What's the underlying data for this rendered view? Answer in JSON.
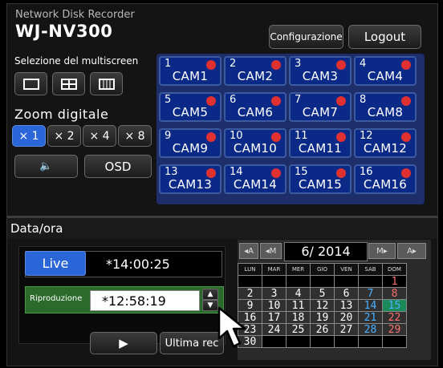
{
  "header": {
    "subtitle": "Network Disk Recorder",
    "model": "WJ-NV300",
    "config_label": "Configurazione",
    "logout_label": "Logout"
  },
  "multiscreen": {
    "title": "Selezione del multiscreen",
    "icons": [
      "single-screen-icon",
      "quad-screen-icon",
      "sixteen-screen-icon"
    ]
  },
  "zoom": {
    "title": "Zoom digitale",
    "options": [
      "× 1",
      "× 2",
      "× 4",
      "× 8"
    ],
    "active": "× 1"
  },
  "controls": {
    "audio_icon": "speaker-icon",
    "osd_label": "OSD"
  },
  "cameras": [
    {
      "num": "1",
      "name": "CAM1"
    },
    {
      "num": "2",
      "name": "CAM2"
    },
    {
      "num": "3",
      "name": "CAM3"
    },
    {
      "num": "4",
      "name": "CAM4"
    },
    {
      "num": "5",
      "name": "CAM5"
    },
    {
      "num": "6",
      "name": "CAM6"
    },
    {
      "num": "7",
      "name": "CAM7"
    },
    {
      "num": "8",
      "name": "CAM8"
    },
    {
      "num": "9",
      "name": "CAM9"
    },
    {
      "num": "10",
      "name": "CAM10"
    },
    {
      "num": "11",
      "name": "CAM11"
    },
    {
      "num": "12",
      "name": "CAM12"
    },
    {
      "num": "13",
      "name": "CAM13"
    },
    {
      "num": "14",
      "name": "CAM14"
    },
    {
      "num": "15",
      "name": "CAM15"
    },
    {
      "num": "16",
      "name": "CAM16"
    }
  ],
  "colors": {
    "live_blue": "#2b66d8",
    "cam_blue": "#0b2a88",
    "rec_red": "#e03030",
    "today_green": "#1a8a5a",
    "playback_green": "#2a6a2a",
    "saturday": "#4ab0ff",
    "sunday": "#ff7070"
  },
  "datetime": {
    "title": "Data/ora",
    "live_label": "Live",
    "live_time": "*14:00:25",
    "playback_label": "Riproduzione",
    "playback_time": "*12:58:19",
    "play_icon": "play-icon",
    "last_rec_label": "Ultima rec"
  },
  "calendar": {
    "prev_year": "◂A",
    "prev_month": "◂M",
    "month_year": "6/ 2014",
    "next_month": "M▸",
    "next_year": "A▸",
    "weekdays": [
      "LUN",
      "MAR",
      "MER",
      "GIO",
      "VEN",
      "SAB",
      "DOM"
    ],
    "weeks": [
      [
        "",
        "",
        "",
        "",
        "",
        "",
        "1"
      ],
      [
        "2",
        "3",
        "4",
        "5",
        "6",
        "7",
        "8"
      ],
      [
        "9",
        "10",
        "11",
        "12",
        "13",
        "14",
        "15"
      ],
      [
        "16",
        "17",
        "18",
        "19",
        "20",
        "21",
        "22"
      ],
      [
        "23",
        "24",
        "25",
        "26",
        "27",
        "28",
        "29"
      ],
      [
        "30",
        "",
        "",
        "",
        "",
        "",
        ""
      ]
    ],
    "today": "15"
  }
}
